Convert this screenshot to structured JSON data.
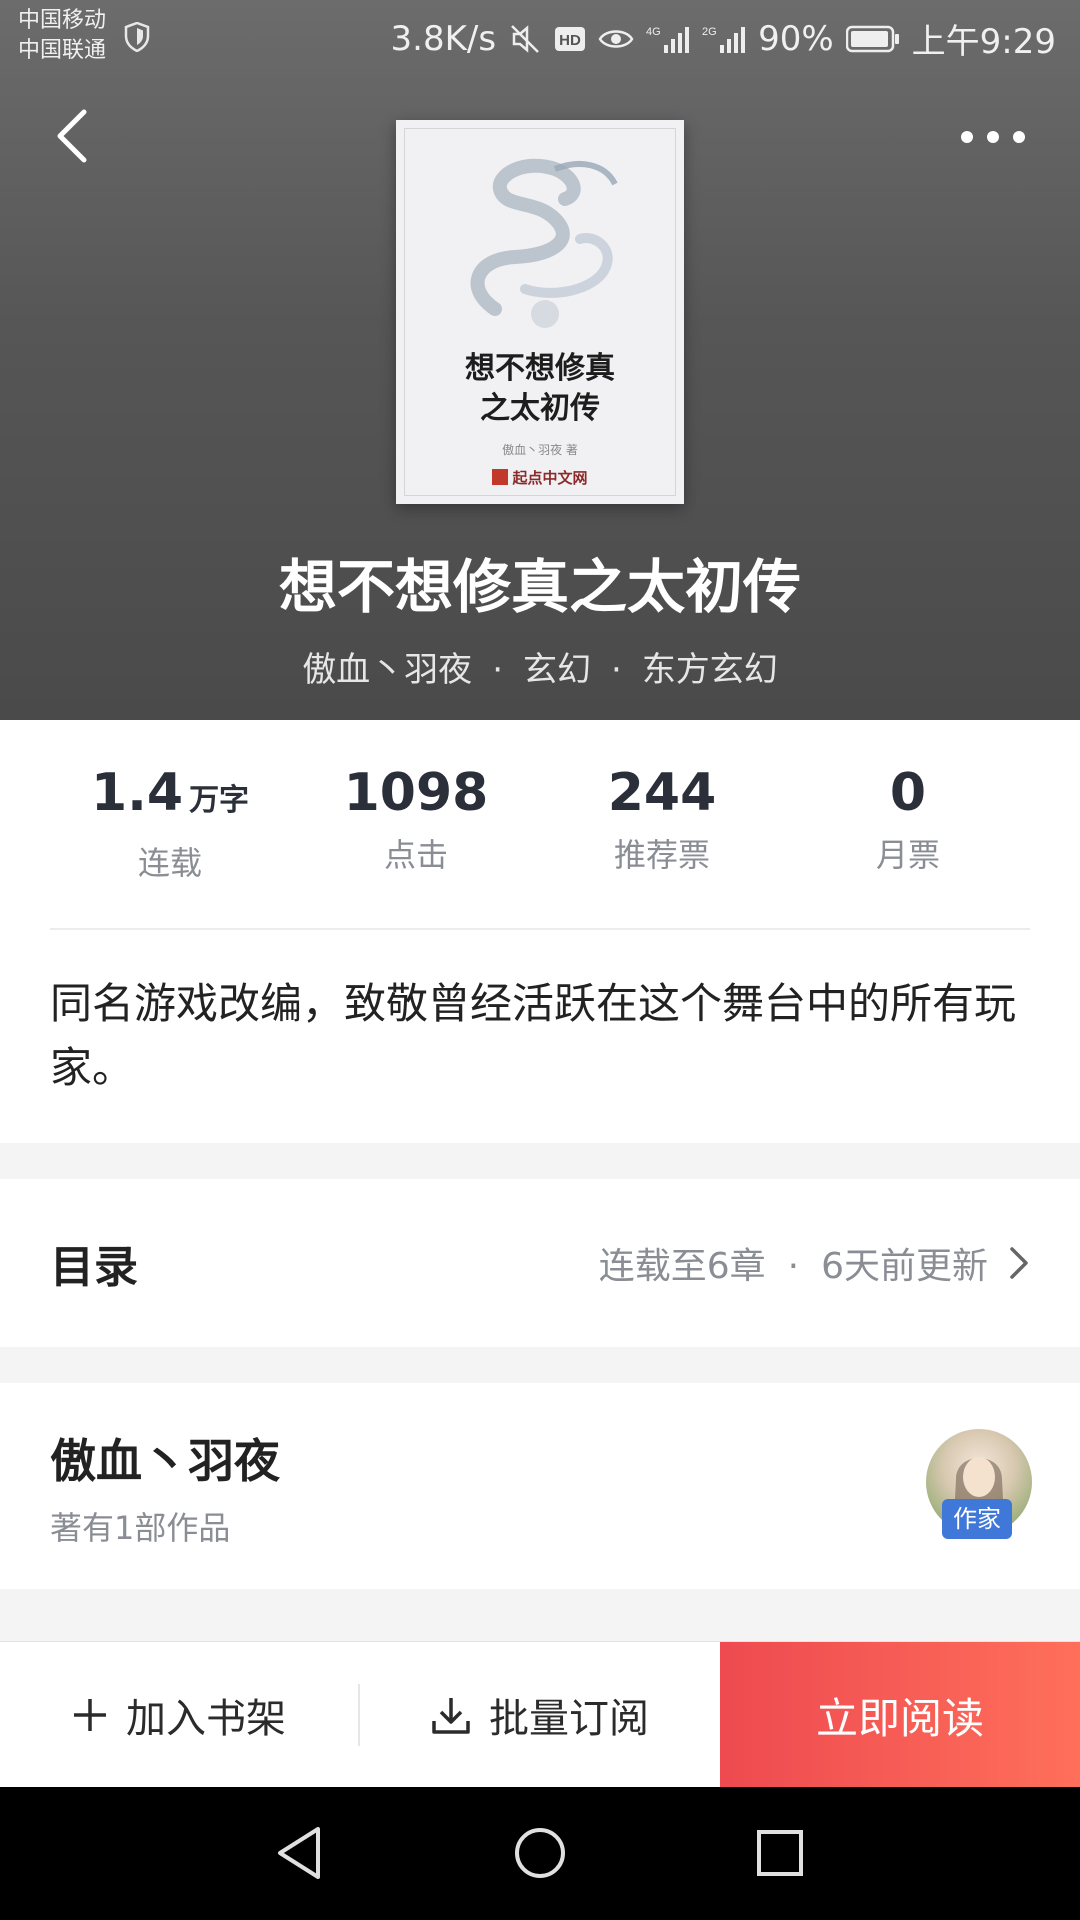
{
  "status_bar": {
    "carrier_1": "中国移动",
    "carrier_2": "中国联通",
    "net_speed": "3.8K/s",
    "battery": "90%",
    "time": "上午9:29"
  },
  "book": {
    "cover_title_line1": "想不想修真",
    "cover_title_line2": "之太初传",
    "cover_author": "傲血丶羽夜 著",
    "cover_publisher": "起点中文网",
    "title": "想不想修真之太初传",
    "author": "傲血丶羽夜",
    "genre": "玄幻",
    "subgenre": "东方玄幻",
    "separator": "·"
  },
  "stats": [
    {
      "value": "1.4",
      "unit": "万字",
      "label": "连载"
    },
    {
      "value": "1098",
      "unit": "",
      "label": "点击"
    },
    {
      "value": "244",
      "unit": "",
      "label": "推荐票"
    },
    {
      "value": "0",
      "unit": "",
      "label": "月票"
    }
  ],
  "intro": "同名游戏改编，致敬曾经活跃在这个舞台中的所有玩家。",
  "toc": {
    "title": "目录",
    "progress": "连载至6章",
    "updated": "6天前更新"
  },
  "author_card": {
    "name": "傲血丶羽夜",
    "works": "著有1部作品",
    "badge": "作家"
  },
  "actions": {
    "add_shelf": "加入书架",
    "batch_subscribe": "批量订阅",
    "read_now": "立即阅读"
  },
  "colors": {
    "accent_start": "#ee4a50",
    "accent_end": "#ff6f5a",
    "badge": "#3f78d8"
  }
}
